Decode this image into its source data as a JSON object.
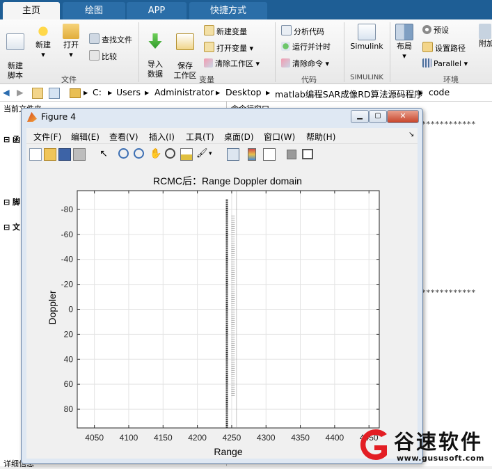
{
  "tabs": [
    "主页",
    "绘图",
    "APP",
    "快捷方式"
  ],
  "ribbon": {
    "new_script": "新建\n脚本",
    "new": "新建",
    "open": "打开",
    "find_files": "查找文件",
    "compare": "比较",
    "group_file": "文件",
    "import_data": "导入\n数据",
    "save_workspace": "保存\n工作区",
    "new_variable": "新建变量",
    "open_variable": "打开变量",
    "clear_workspace": "清除工作区",
    "group_variable": "变量",
    "analyze_code": "分析代码",
    "run_and_time": "运行并计时",
    "clear_commands": "清除命令",
    "group_code": "代码",
    "simulink": "Simulink",
    "group_simulink": "SIMULINK",
    "layout": "布局",
    "preferences": "预设",
    "set_path": "设置路径",
    "parallel": "Parallel",
    "group_environment": "环境",
    "addons": "附加"
  },
  "address": {
    "segments": [
      "C:",
      "Users",
      "Administrator",
      "Desktop",
      "matlab编程SAR成像RD算法源码程序",
      "code"
    ]
  },
  "left_panel": {
    "title": "当前文件夹",
    "rows": [
      "函",
      "脚",
      "文"
    ],
    "bottom": "详细信息"
  },
  "right_panel": {
    "title": "命令行窗口"
  },
  "figure": {
    "title": "Figure 4",
    "menus": [
      "文件(F)",
      "编辑(E)",
      "查看(V)",
      "插入(I)",
      "工具(T)",
      "桌面(D)",
      "窗口(W)",
      "帮助(H)"
    ]
  },
  "chart_data": {
    "type": "scatter",
    "title": "RCMC后：Range Doppler domain",
    "xlabel": "Range",
    "ylabel": "Doppler",
    "xlim": [
      4025,
      4465
    ],
    "ylim": [
      -95,
      95
    ],
    "y_reversed": true,
    "xticks": [
      4050,
      4100,
      4150,
      4200,
      4250,
      4300,
      4350,
      4400,
      4450
    ],
    "yticks": [
      -80,
      -60,
      -40,
      -20,
      0,
      20,
      40,
      60,
      80
    ],
    "grid": true,
    "series": [
      {
        "x": 4243,
        "y_range": [
          -88,
          95
        ],
        "intensity": "strong"
      },
      {
        "x": 4252,
        "y_range": [
          -75,
          70
        ],
        "intensity": "weak"
      },
      {
        "x": 4257,
        "y_range": [
          -95,
          95
        ],
        "intensity": "faint"
      }
    ]
  },
  "watermark": {
    "brand": "谷速软件",
    "url": "www.gususoft.com",
    "color": "#e31e24"
  }
}
